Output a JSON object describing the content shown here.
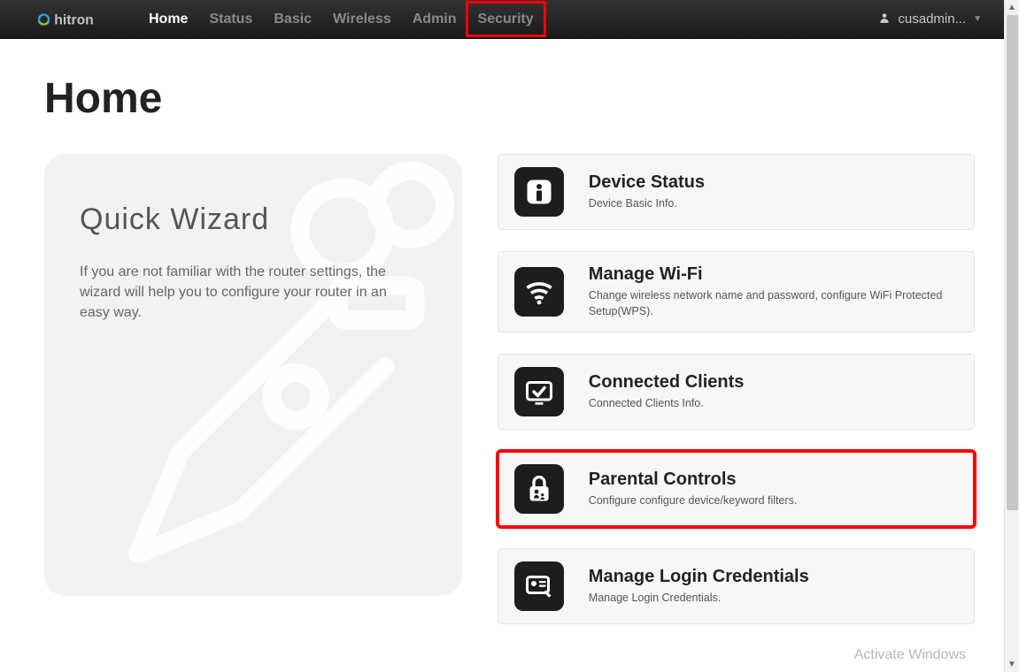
{
  "brand": "hitron",
  "nav": {
    "items": [
      {
        "label": "Home",
        "active": true,
        "highlighted": false
      },
      {
        "label": "Status",
        "active": false,
        "highlighted": false
      },
      {
        "label": "Basic",
        "active": false,
        "highlighted": false
      },
      {
        "label": "Wireless",
        "active": false,
        "highlighted": false
      },
      {
        "label": "Admin",
        "active": false,
        "highlighted": false
      },
      {
        "label": "Security",
        "active": false,
        "highlighted": true
      }
    ]
  },
  "user": {
    "label": "cusadmin..."
  },
  "page": {
    "title": "Home"
  },
  "wizard": {
    "title": "Quick Wizard",
    "text": "If you are not familiar with the router settings, the wizard will help you to configure your router in an easy way."
  },
  "tiles": [
    {
      "icon": "info-icon",
      "title": "Device Status",
      "desc": "Device Basic Info.",
      "highlighted": false
    },
    {
      "icon": "wifi-icon",
      "title": "Manage Wi-Fi",
      "desc": "Change wireless network name and password, configure WiFi Protected Setup(WPS).",
      "highlighted": false
    },
    {
      "icon": "clients-icon",
      "title": "Connected Clients",
      "desc": "Connected Clients Info.",
      "highlighted": false
    },
    {
      "icon": "lock-parent-icon",
      "title": "Parental Controls",
      "desc": "Configure configure device/keyword filters.",
      "highlighted": true
    },
    {
      "icon": "credentials-icon",
      "title": "Manage Login Credentials",
      "desc": "Manage Login Credentials.",
      "highlighted": false
    }
  ],
  "watermark": "Activate Windows"
}
